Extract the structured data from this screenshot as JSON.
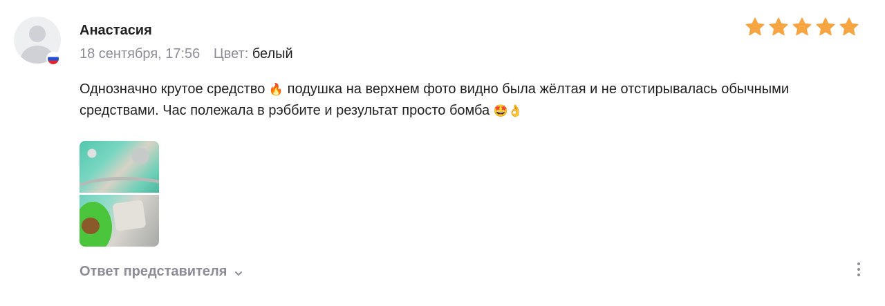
{
  "review": {
    "author": "Анастасия",
    "date": "18 сентября, 17:56",
    "color_label": "Цвет:",
    "color_value": "белый",
    "rating": 5,
    "text_part1": "Однозначно крутое средство ",
    "emoji1": "🔥",
    "text_part2": " подушка на верхнем фото видно была жёлтая и не отстирывалась обычными средствами. Час полежала в рэббите и результат просто бомба ",
    "emoji2": "🤩👌",
    "reply_label": "Ответ представителя"
  },
  "icons": {
    "avatar": "user-placeholder-icon",
    "flag": "russia-flag-icon",
    "star": "star-icon",
    "chevron": "chevron-down-icon",
    "more": "more-vertical-icon"
  },
  "colors": {
    "star": "#f7a542",
    "muted_text": "#8c8c96",
    "text": "#1f1f1f"
  }
}
